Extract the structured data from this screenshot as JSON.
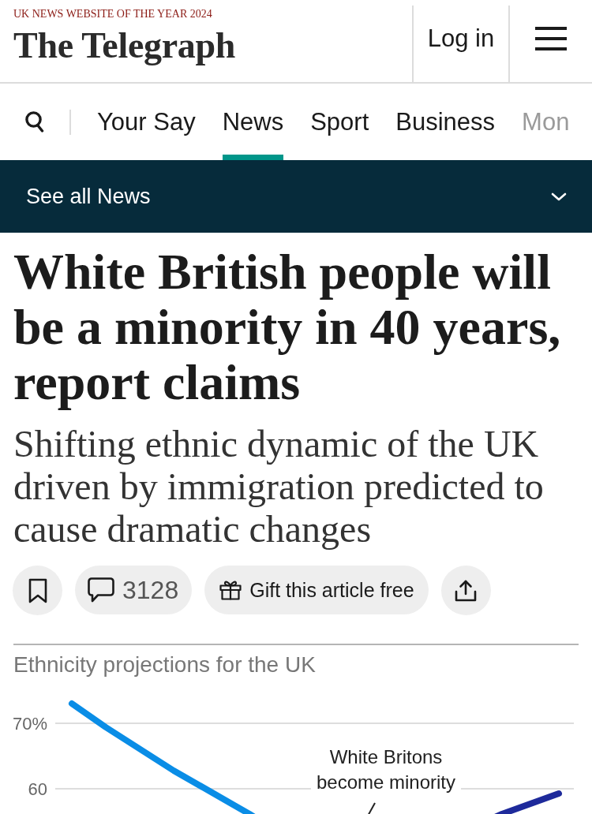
{
  "header": {
    "award": "UK NEWS WEBSITE OF THE YEAR 2024",
    "logo": "The Telegraph",
    "login": "Log in"
  },
  "nav": {
    "items": [
      {
        "label": "Your Say",
        "selected": false,
        "faded": false
      },
      {
        "label": "News",
        "selected": true,
        "faded": false
      },
      {
        "label": "Sport",
        "selected": false,
        "faded": false
      },
      {
        "label": "Business",
        "selected": false,
        "faded": false
      },
      {
        "label": "Mon",
        "selected": false,
        "faded": true
      }
    ]
  },
  "section_bar": {
    "label": "See all News",
    "expanded": false
  },
  "article": {
    "headline": "White British people will be a minority in 40 years, report claims",
    "standfirst": "Shifting ethnic dynamic of the UK driven by immigration predicted to cause dramatic changes",
    "comment_count": "3128",
    "gift_label": "Gift this article free"
  },
  "chart": {
    "title": "Ethnicity projections for the UK",
    "y_tick_labels": [
      "70%",
      "60"
    ],
    "annotation": "White Britons become minority"
  }
}
